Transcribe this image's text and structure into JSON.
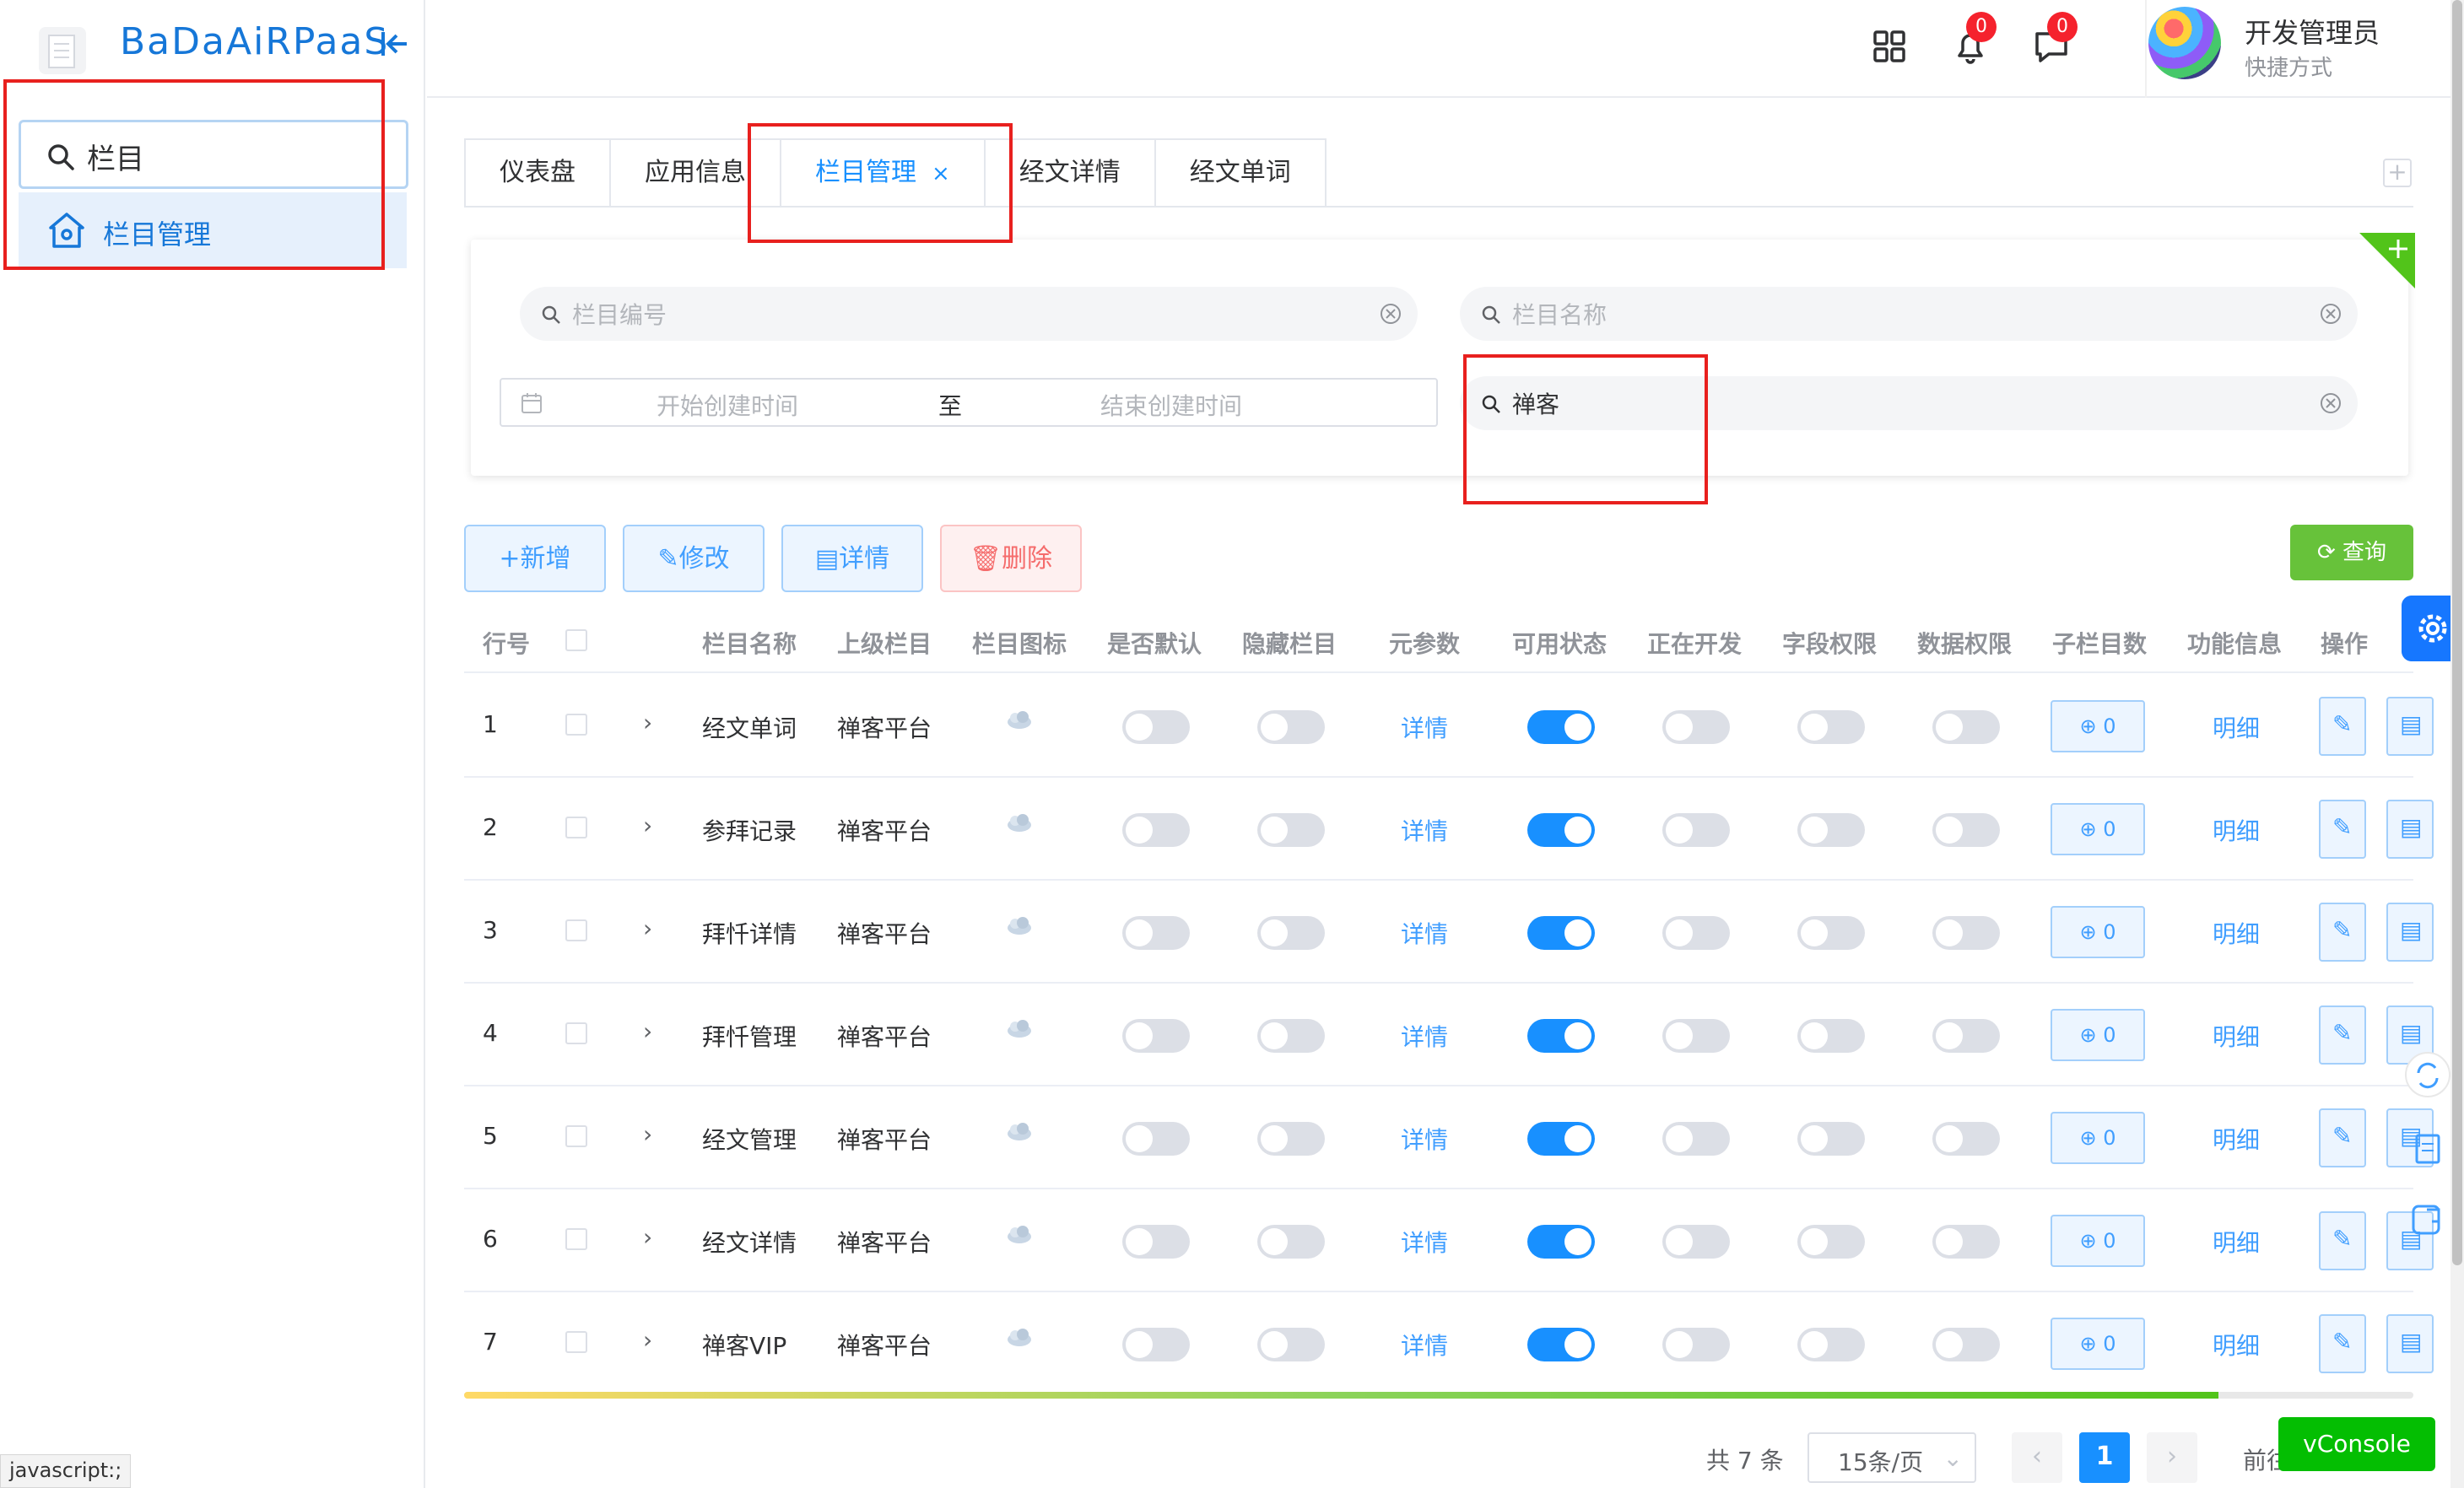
{
  "sidebar": {
    "title": "BaDaAiRPaaS",
    "search_value": "栏目",
    "menu_item": "栏目管理",
    "status_url": "javascript:;"
  },
  "header": {
    "notifications_badge": "0",
    "messages_badge": "0",
    "user_name": "开发管理员",
    "user_sub": "快捷方式"
  },
  "tabs": [
    {
      "label": "仪表盘",
      "active": false
    },
    {
      "label": "应用信息",
      "active": false
    },
    {
      "label": "栏目管理",
      "active": true,
      "close": "×"
    },
    {
      "label": "经文详情",
      "active": false
    },
    {
      "label": "经文单词",
      "active": false
    }
  ],
  "filters": {
    "code_placeholder": "栏目编号",
    "name_placeholder": "栏目名称",
    "start_placeholder": "开始创建时间",
    "range_sep": "至",
    "end_placeholder": "结束创建时间",
    "parent_value": "禅客"
  },
  "actions": {
    "add": "+新增",
    "edit": "修改",
    "detail": "详情",
    "delete": "删除",
    "query": "查询"
  },
  "table": {
    "headers": [
      "行号",
      "栏目名称",
      "上级栏目",
      "栏目图标",
      "是否默认",
      "隐藏栏目",
      "元参数",
      "可用状态",
      "正在开发",
      "字段权限",
      "数据权限",
      "子栏目数",
      "功能信息",
      "操作"
    ],
    "rows": [
      {
        "no": "1",
        "name": "经文单词",
        "parent": "禅客平台",
        "meta": "详情",
        "is_default": false,
        "hidden": false,
        "enabled": true,
        "dev": false,
        "field_perm": false,
        "data_perm": false,
        "children": "0",
        "func": "明细"
      },
      {
        "no": "2",
        "name": "参拜记录",
        "parent": "禅客平台",
        "meta": "详情",
        "is_default": false,
        "hidden": false,
        "enabled": true,
        "dev": false,
        "field_perm": false,
        "data_perm": false,
        "children": "0",
        "func": "明细"
      },
      {
        "no": "3",
        "name": "拜忏详情",
        "parent": "禅客平台",
        "meta": "详情",
        "is_default": false,
        "hidden": false,
        "enabled": true,
        "dev": false,
        "field_perm": false,
        "data_perm": false,
        "children": "0",
        "func": "明细"
      },
      {
        "no": "4",
        "name": "拜忏管理",
        "parent": "禅客平台",
        "meta": "详情",
        "is_default": false,
        "hidden": false,
        "enabled": true,
        "dev": false,
        "field_perm": false,
        "data_perm": false,
        "children": "0",
        "func": "明细"
      },
      {
        "no": "5",
        "name": "经文管理",
        "parent": "禅客平台",
        "meta": "详情",
        "is_default": false,
        "hidden": false,
        "enabled": true,
        "dev": false,
        "field_perm": false,
        "data_perm": false,
        "children": "0",
        "func": "明细"
      },
      {
        "no": "6",
        "name": "经文详情",
        "parent": "禅客平台",
        "meta": "详情",
        "is_default": false,
        "hidden": false,
        "enabled": true,
        "dev": false,
        "field_perm": false,
        "data_perm": false,
        "children": "0",
        "func": "明细"
      },
      {
        "no": "7",
        "name": "禅客VIP",
        "parent": "禅客平台",
        "meta": "详情",
        "is_default": false,
        "hidden": false,
        "enabled": true,
        "dev": false,
        "field_perm": false,
        "data_perm": false,
        "children": "0",
        "func": "明细"
      }
    ]
  },
  "pagination": {
    "total": "共 7 条",
    "page_size": "15条/页",
    "prev": "‹",
    "current": "1",
    "next": "›",
    "goto": "前往",
    "scroll_progress": 0.9
  },
  "vconsole": "vConsole",
  "colors": {
    "primary": "#1890ff",
    "brand_title": "#1677d8",
    "success": "#67c23a",
    "danger": "#f56c6c",
    "badge": "#f5222d",
    "annotation": "#e8201e"
  }
}
